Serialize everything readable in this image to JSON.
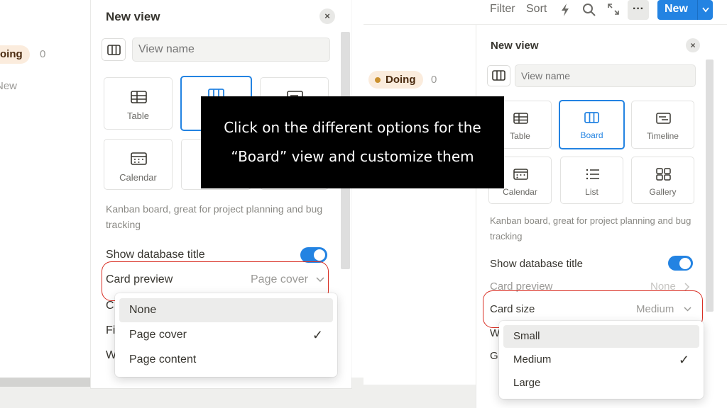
{
  "left": {
    "board": {
      "status_label": "oing",
      "count": "0",
      "new_label": "New"
    },
    "panel": {
      "title": "New view",
      "close": "×",
      "name_placeholder": "View name",
      "layouts": [
        {
          "label": "Table",
          "icon": "table-icon"
        },
        {
          "label": "",
          "icon": "board-icon"
        },
        {
          "label": "",
          "icon": "timeline-icon"
        },
        {
          "label": "Calendar",
          "icon": "calendar-icon"
        }
      ],
      "description": "Kanban board, great for project planning and bug tracking",
      "show_title_label": "Show database title",
      "card_preview_label": "Card preview",
      "card_preview_value": "Page cover",
      "hidden_row_letters": [
        "C",
        "Fi",
        "W"
      ]
    },
    "menu": {
      "items": [
        "None",
        "Page cover",
        "Page content"
      ],
      "selected": "Page cover",
      "highlighted": "None"
    }
  },
  "right": {
    "toolbar": {
      "filter": "Filter",
      "sort": "Sort",
      "more": "···",
      "new": "New"
    },
    "board": {
      "status_label": "Doing",
      "count": "0"
    },
    "panel": {
      "title": "New view",
      "close": "×",
      "name_placeholder": "View name",
      "layouts": [
        {
          "label": "Table",
          "icon": "table-icon"
        },
        {
          "label": "Board",
          "icon": "board-icon",
          "selected": true
        },
        {
          "label": "Timeline",
          "icon": "timeline-icon"
        },
        {
          "label": "Calendar",
          "icon": "calendar-icon"
        },
        {
          "label": "List",
          "icon": "list-icon"
        },
        {
          "label": "Gallery",
          "icon": "gallery-icon"
        }
      ],
      "description": "Kanban board, great for project planning and bug tracking",
      "show_title_label": "Show database title",
      "card_preview_label": "Card preview",
      "card_preview_value": "None",
      "card_size_label": "Card size",
      "card_size_value": "Medium",
      "hidden_row_letters": [
        "W",
        "G"
      ]
    },
    "menu": {
      "items": [
        "Small",
        "Medium",
        "Large"
      ],
      "selected": "Medium",
      "highlighted": "Small"
    }
  },
  "overlay": {
    "line1": "Click on the different options for the",
    "line2": "“Board” view and customize them"
  },
  "colors": {
    "accent": "#2383e2",
    "annotation": "#d93025",
    "status_bg": "#fbecdd"
  }
}
